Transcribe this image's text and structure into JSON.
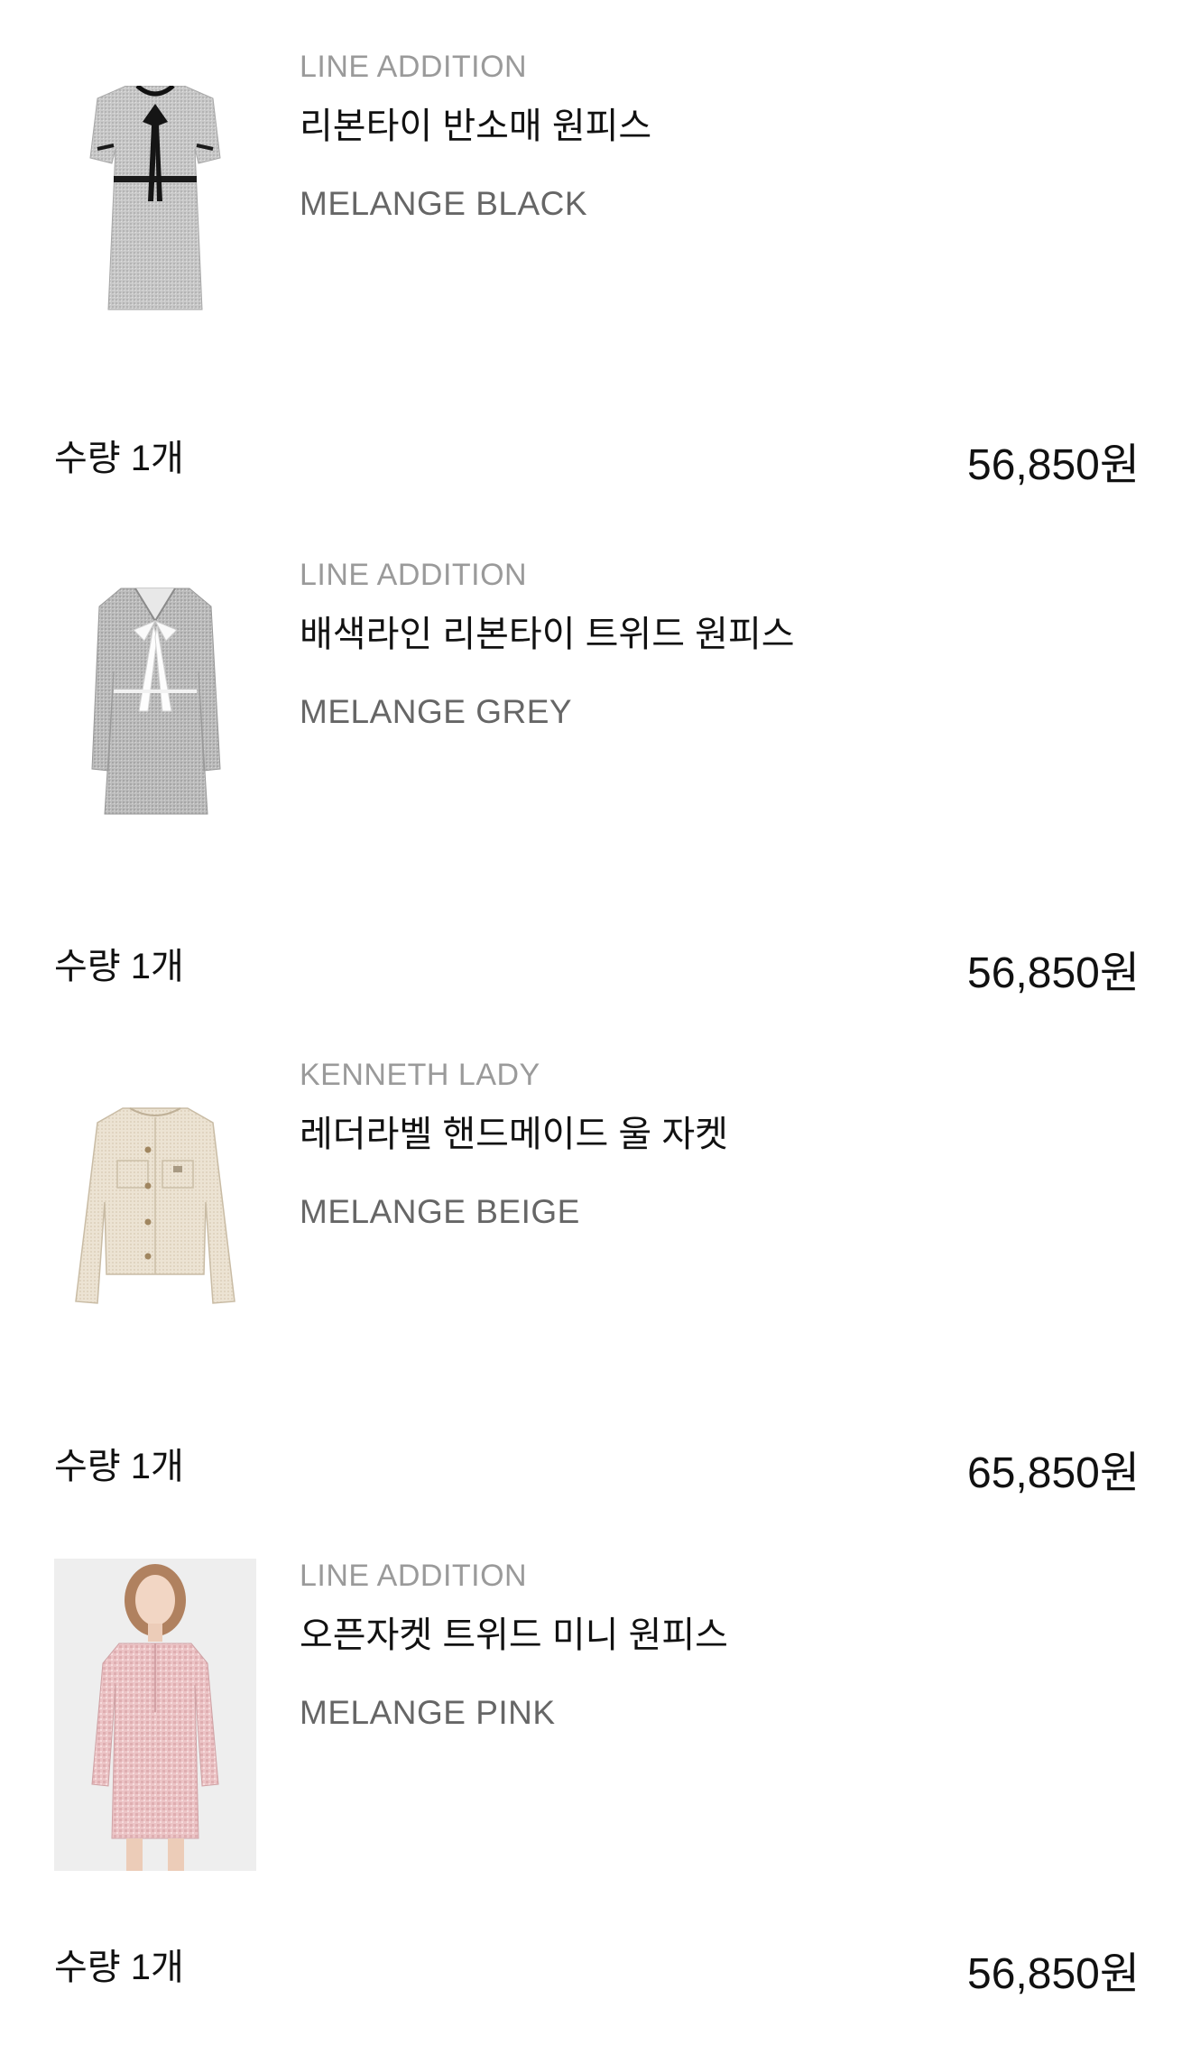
{
  "order_items": [
    {
      "brand": "LINE ADDITION",
      "name": "리본타이 반소매 원피스",
      "option": "MELANGE BLACK",
      "quantity": "수량 1개",
      "price": "56,850원",
      "image_icon": "short-sleeve-tweed-dress-icon"
    },
    {
      "brand": "LINE ADDITION",
      "name": "배색라인 리본타이 트위드 원피스",
      "option": "MELANGE GREY",
      "quantity": "수량 1개",
      "price": "56,850원",
      "image_icon": "long-sleeve-bow-dress-icon"
    },
    {
      "brand": "KENNETH LADY",
      "name": "레더라벨 핸드메이드 울 자켓",
      "option": "MELANGE BEIGE",
      "quantity": "수량 1개",
      "price": "65,850원",
      "image_icon": "wool-jacket-icon"
    },
    {
      "brand": "LINE ADDITION",
      "name": "오픈자켓 트위드 미니 원피스",
      "option": "MELANGE PINK",
      "quantity": "수량 1개",
      "price": "56,850원",
      "image_icon": "model-photo-pink-dress-icon"
    }
  ],
  "colors": {
    "brand_text": "#9a9a9a",
    "option_text": "#666666",
    "primary_text": "#111111"
  }
}
